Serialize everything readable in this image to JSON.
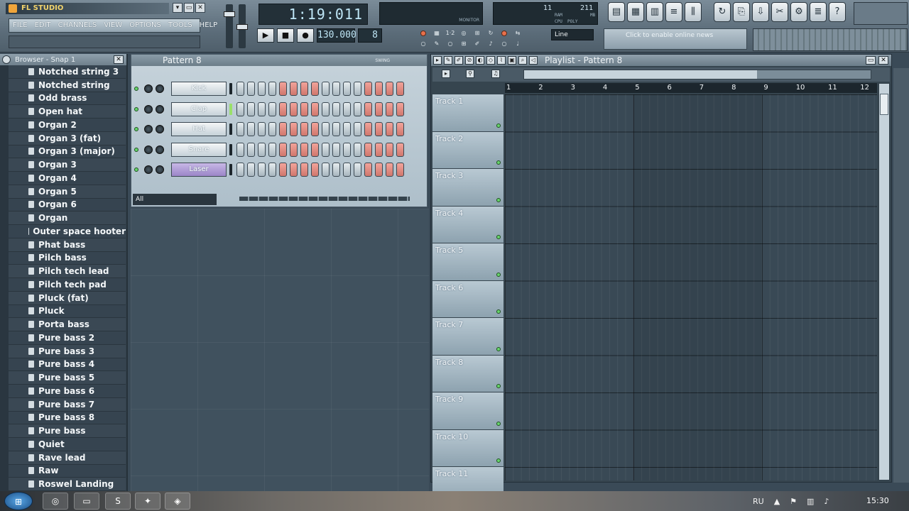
{
  "app": {
    "logo_text": "FL STUDIO",
    "window_buttons": [
      "▾",
      "▭",
      "✕"
    ],
    "menu": [
      "FILE",
      "EDIT",
      "CHANNELS",
      "VIEW",
      "OPTIONS",
      "TOOLS",
      "HELP"
    ]
  },
  "transport": {
    "time": "1:19:011",
    "play": "▶",
    "stop": "■",
    "record": "●",
    "tempo": "130.000",
    "pattern_number": "8",
    "snap": "Line"
  },
  "monitor_label": "MONITOR",
  "cpu": {
    "ram_value": "11",
    "poly_value": "211",
    "ram_label": "RAM",
    "mb_label": "MB",
    "cpu_label": "CPU",
    "poly_label": "POLY"
  },
  "news_text": "Click to enable online news",
  "browser": {
    "title": "Browser - Snap 1",
    "close": "✕",
    "items": [
      "Notched string 3",
      "Notched string",
      "Odd brass",
      "Open hat",
      "Organ 2",
      "Organ 3 (fat)",
      "Organ 3 (major)",
      "Organ 3",
      "Organ 4",
      "Organ 5",
      "Organ 6",
      "Organ",
      "Outer space hooter",
      "Phat bass",
      "Pilch bass",
      "Pilch tech lead",
      "Pilch tech pad",
      "Pluck (fat)",
      "Pluck",
      "Porta bass",
      "Pure bass 2",
      "Pure bass 3",
      "Pure bass 4",
      "Pure bass 5",
      "Pure bass 6",
      "Pure bass 7",
      "Pure bass 8",
      "Pure bass",
      "Quiet",
      "Rave lead",
      "Raw",
      "Roswel Landing"
    ]
  },
  "step_sequencer": {
    "title": "Pattern 8",
    "swing_label": "SWING",
    "filter": "All",
    "channels": [
      {
        "name": "Kick",
        "selected": false,
        "active": false
      },
      {
        "name": "Clap",
        "selected": false,
        "active": true
      },
      {
        "name": "Hat",
        "selected": false,
        "active": false
      },
      {
        "name": "Snare",
        "selected": false,
        "active": false
      },
      {
        "name": "Laser",
        "selected": true,
        "active": false
      }
    ],
    "steps": 16
  },
  "playlist": {
    "title": "Playlist - Pattern 8",
    "close": "✕",
    "ruler": [
      "1",
      "2",
      "3",
      "4",
      "5",
      "6",
      "7",
      "8",
      "9",
      "10",
      "11",
      "12"
    ],
    "tracks": [
      "Track 1",
      "Track 2",
      "Track 3",
      "Track 4",
      "Track 5",
      "Track 6",
      "Track 7",
      "Track 8",
      "Track 9",
      "Track 10",
      "Track 11"
    ]
  },
  "taskbar": {
    "language": "RU",
    "clock": "15:30"
  },
  "colors": {
    "step_red": "#d0776d",
    "led_green": "#68d46c",
    "selected_channel": "#9c86c8"
  }
}
